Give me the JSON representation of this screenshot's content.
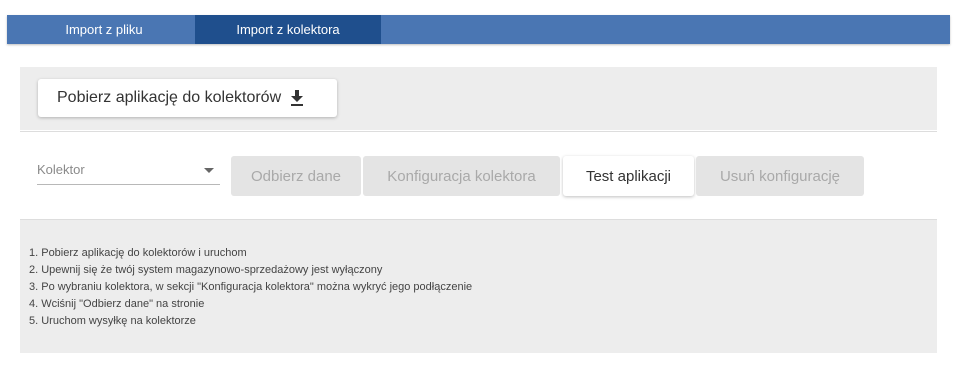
{
  "tabs": [
    {
      "label": "Import z pliku",
      "active": false
    },
    {
      "label": "Import z kolektora",
      "active": true
    }
  ],
  "download": {
    "label": "Pobierz aplikację do kolektorów",
    "icon": "download-icon"
  },
  "controls": {
    "collector_select": {
      "placeholder": "Kolektor",
      "icon": "chevron-down-icon"
    },
    "buttons": {
      "receive_data": {
        "label": "Odbierz dane",
        "enabled": false
      },
      "collector_config": {
        "label": "Konfiguracja kolektora",
        "enabled": false
      },
      "test_app": {
        "label": "Test aplikacji",
        "enabled": true
      },
      "delete_config": {
        "label": "Usuń konfigurację",
        "enabled": false
      }
    }
  },
  "instructions": [
    "1. Pobierz aplikację do kolektorów i uruchom",
    "2. Upewnij się że twój system magazynowo-sprzedażowy jest wyłączony",
    "3. Po wybraniu kolektora, w sekcji \"Konfiguracja kolektora\" można wykryć jego podłączenie",
    "4. Wciśnij \"Odbierz dane\" na stronie",
    "5. Uruchom wysyłkę na kolektorze"
  ],
  "colors": {
    "tabbar": "#4a76b3",
    "tab_active": "#1f4f8d",
    "card_bg": "#ededed",
    "disabled_btn": "#e4e4e4"
  }
}
